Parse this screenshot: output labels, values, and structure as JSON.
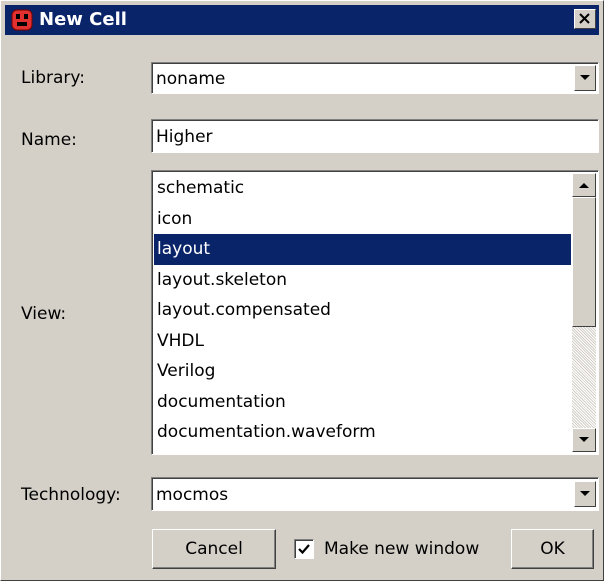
{
  "window": {
    "title": "New Cell",
    "close_label": "Close"
  },
  "form": {
    "library_label": "Library:",
    "library_value": "noname",
    "name_label": "Name:",
    "name_value": "Higher",
    "view_label": "View:",
    "views": [
      "schematic",
      "icon",
      "layout",
      "layout.skeleton",
      "layout.compensated",
      "VHDL",
      "Verilog",
      "documentation",
      "documentation.waveform"
    ],
    "selected_view": "layout",
    "technology_label": "Technology:",
    "technology_value": "mocmos"
  },
  "buttons": {
    "cancel": "Cancel",
    "make_new_window": "Make new window",
    "make_new_window_checked": true,
    "ok": "OK"
  },
  "colors": {
    "title_bar": "#0a246a",
    "selection": "#0a246a",
    "dialog_bg": "#d4d0c8"
  }
}
